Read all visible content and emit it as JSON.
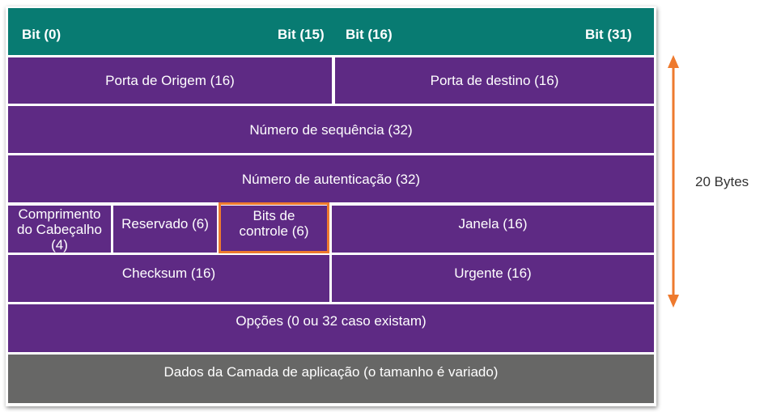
{
  "header": {
    "bit0": "Bit (0)",
    "bit15": "Bit (15)",
    "bit16": "Bit (16)",
    "bit31": "Bit (31)"
  },
  "rows": {
    "source_port": "Porta de Origem (16)",
    "dest_port": "Porta de destino (16)",
    "sequence_number": "Número de sequência (32)",
    "ack_number": "Número de autenticação (32)",
    "header_length": "Comprimento do Cabeçalho (4)",
    "reserved": "Reservado (6)",
    "control_bits": "Bits de controle (6)",
    "window": "Janela (16)",
    "checksum": "Checksum (16)",
    "urgent": "Urgente (16)",
    "options": "Opções (0 ou 32 caso existam)",
    "app_data": "Dados da Camada de aplicação (o tamanho é variado)"
  },
  "size_annotation": "20 Bytes",
  "colors": {
    "header": "#087b72",
    "field": "#5e2a84",
    "data": "#676766",
    "highlight": "#ee7a2e",
    "arrow": "#ee7a2e"
  }
}
